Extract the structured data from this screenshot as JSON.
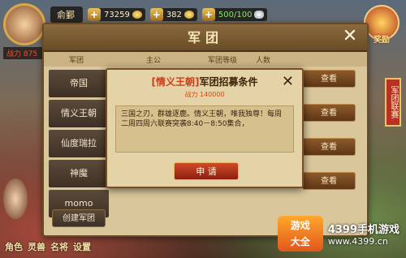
{
  "hud": {
    "player_name": "俞鄞",
    "gold": "73259",
    "ingots": "382",
    "stamina": "500/100",
    "power_label": "战力 875"
  },
  "reward": {
    "label": "奖励"
  },
  "side_banner": {
    "text": "军团联赛"
  },
  "dialog": {
    "title": "军团",
    "close_icon": "close-icon",
    "columns": [
      "军团",
      "主公",
      "军团等级",
      "人数"
    ],
    "sidebar_items": [
      "帝国",
      "情义王朝",
      "仙度瑞拉",
      "神魔",
      "momo"
    ],
    "view_label": "查看",
    "create_label": "创建军团"
  },
  "popup": {
    "title_highlight": "[情义王朝]",
    "title_rest": "军团招募条件",
    "power": "战力 140000",
    "body": "三国之刃，群雄逐鹿。情义王朝，唯我独尊！每周二周四周六联赛突袭8:40－8:50集合，",
    "apply_label": "申 请",
    "close_icon": "close-icon"
  },
  "bottom_bar": [
    "角色",
    "灵兽",
    "名将",
    "设置"
  ],
  "watermark": {
    "logo_top": "游戏",
    "logo_bottom": "大全",
    "brand": "4399手机游戏",
    "url": "www.4399.cn"
  },
  "colors": {
    "accent": "#c8401a",
    "panel": "#d9c79b",
    "apply": "#d14a2a"
  }
}
